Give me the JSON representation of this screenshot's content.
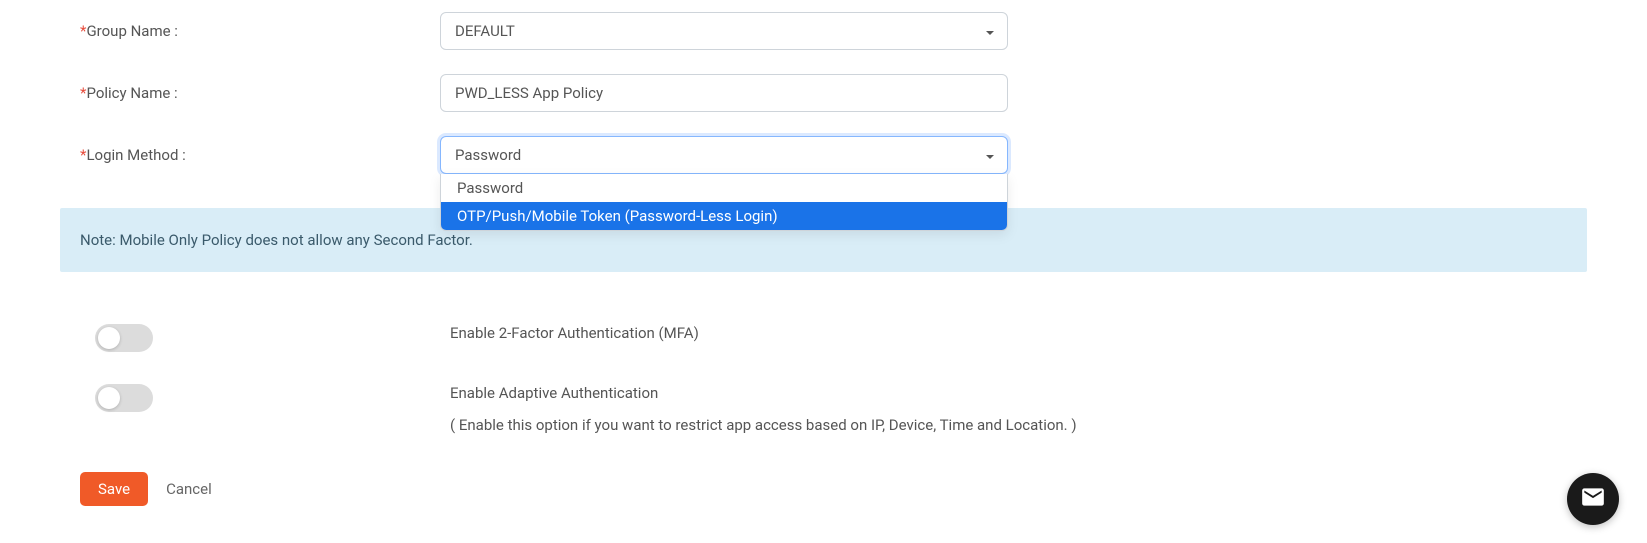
{
  "form": {
    "group_name": {
      "label": "Group Name :",
      "value": "DEFAULT"
    },
    "policy_name": {
      "label": "Policy Name :",
      "value": "PWD_LESS App Policy"
    },
    "login_method": {
      "label": "Login Method :",
      "selected": "Password",
      "options": [
        "Password",
        "OTP/Push/Mobile Token (Password-Less Login)"
      ]
    }
  },
  "note": "Note: Mobile Only Policy does not allow any Second Factor.",
  "toggles": {
    "mfa": {
      "label": "Enable 2-Factor Authentication (MFA)",
      "enabled": false
    },
    "adaptive": {
      "label": "Enable Adaptive Authentication",
      "sublabel": "( Enable this option if you want to restrict app access based on IP, Device, Time and Location. )",
      "enabled": false
    }
  },
  "buttons": {
    "save": "Save",
    "cancel": "Cancel"
  }
}
